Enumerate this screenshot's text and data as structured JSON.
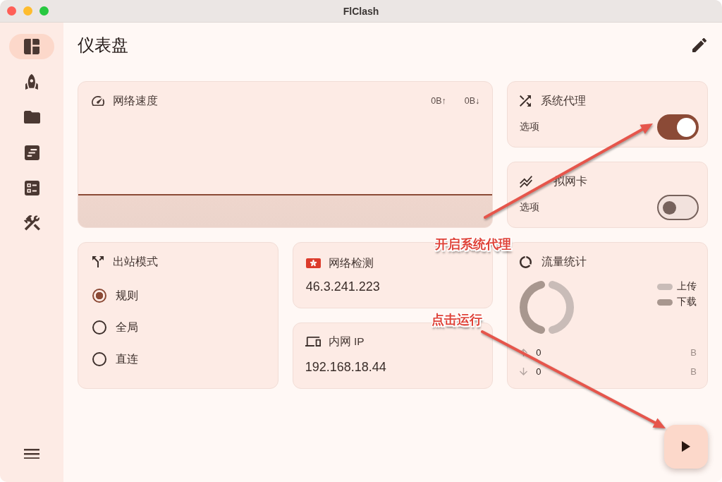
{
  "window": {
    "title": "FlClash"
  },
  "sidebar": {
    "items": [
      {
        "selected": true
      },
      {
        "selected": false
      },
      {
        "selected": false
      },
      {
        "selected": false
      },
      {
        "selected": false
      },
      {
        "selected": false
      }
    ]
  },
  "page": {
    "title": "仪表盘"
  },
  "network_speed": {
    "title": "网络速度",
    "upload": "0B↑",
    "download": "0B↓"
  },
  "system_proxy": {
    "title": "系统代理",
    "subtitle": "选项",
    "on": true
  },
  "virtual_nic": {
    "title": "拟网卡",
    "subtitle": "选项",
    "on": false
  },
  "outbound_mode": {
    "title": "出站模式",
    "options": [
      {
        "label": "规则",
        "selected": true
      },
      {
        "label": "全局",
        "selected": false
      },
      {
        "label": "直连",
        "selected": false
      }
    ]
  },
  "network_check": {
    "title": "网络检测",
    "value": "46.3.241.223"
  },
  "intranet_ip": {
    "title": "内网 IP",
    "value": "192.168.18.44"
  },
  "traffic": {
    "title": "流量统计",
    "legend": [
      {
        "label": "上传",
        "color": "#c9bcb8"
      },
      {
        "label": "下载",
        "color": "#a8978f"
      }
    ],
    "rows": [
      {
        "kind": "upload",
        "value": "0",
        "unit": "B"
      },
      {
        "kind": "download",
        "value": "0",
        "unit": "B"
      }
    ]
  },
  "annotations": [
    {
      "text": "开启系统代理"
    },
    {
      "text": "点击运行"
    }
  ]
}
